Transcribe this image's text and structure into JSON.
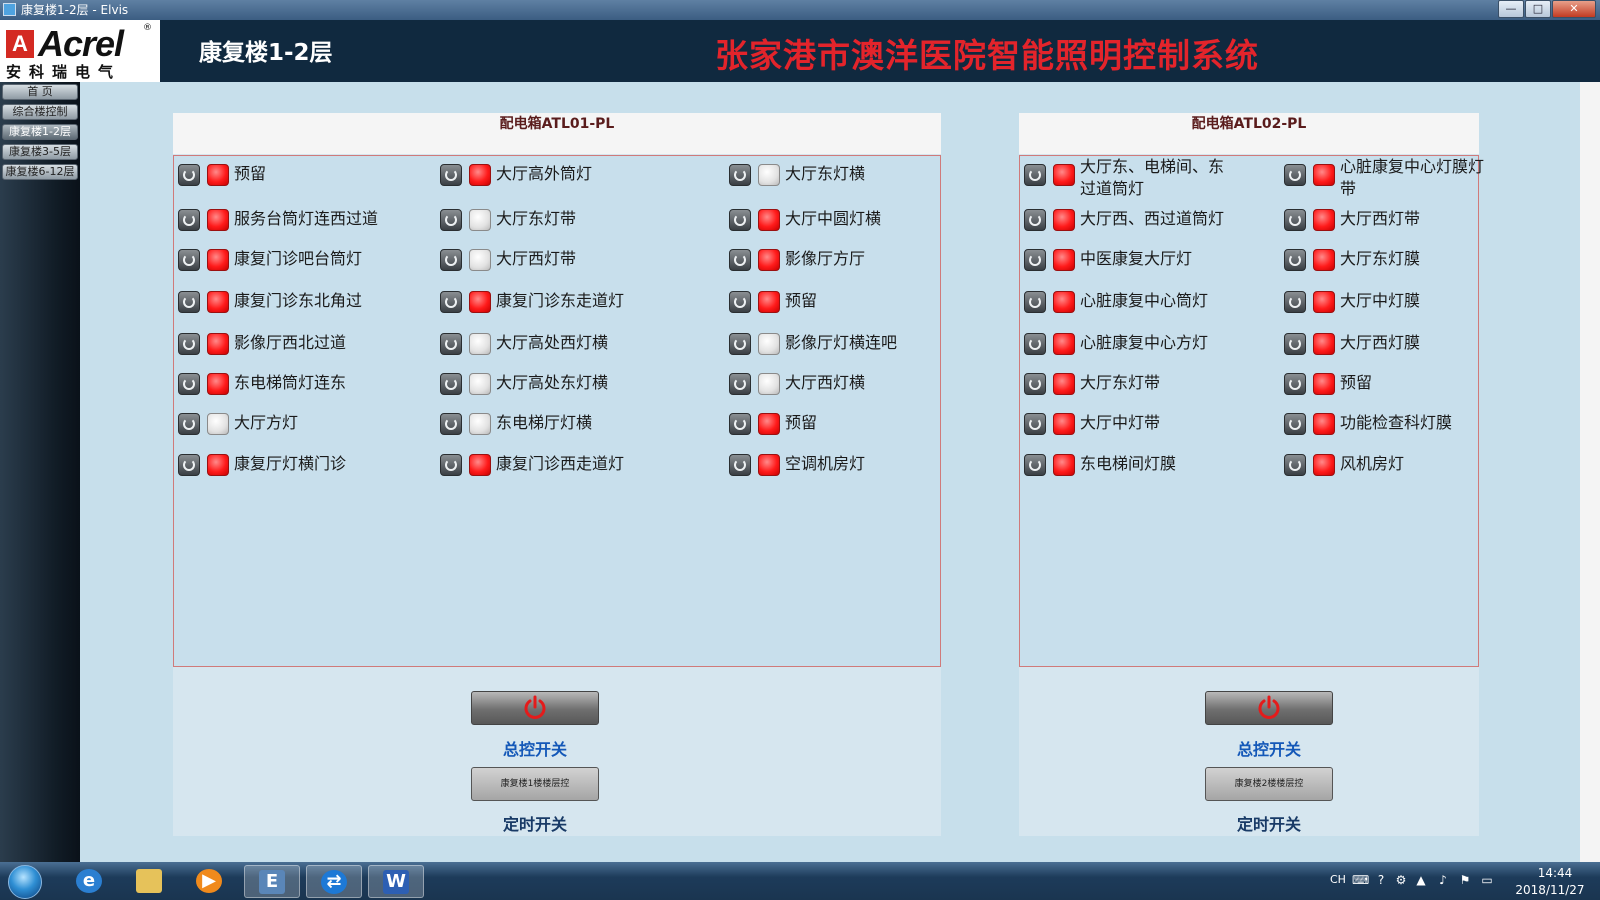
{
  "window": {
    "title": "康复楼1-2层 - Elvis",
    "minimize": "—",
    "maximize": "□",
    "close": "✕"
  },
  "header": {
    "logo_word": "Acrel",
    "logo_reg": "®",
    "logo_sub": "安科瑞电气",
    "floor_title": "康复楼1-2层",
    "system_title": "张家港市澳洋医院智能照明控制系统"
  },
  "sidebar": {
    "items": [
      {
        "label": "首 页",
        "active": false
      },
      {
        "label": "综合楼控制",
        "active": false
      },
      {
        "label": "康复楼1-2层",
        "active": true
      },
      {
        "label": "康复楼3-5层",
        "active": false
      },
      {
        "label": "康复楼6-12层",
        "active": false
      }
    ]
  },
  "panels": [
    {
      "title": "配电箱ATL01-PL",
      "columns": [
        [
          {
            "label": "预留",
            "on": true
          },
          {
            "label": "服务台筒灯连西过道",
            "on": true
          },
          {
            "label": "康复门诊吧台筒灯",
            "on": true
          },
          {
            "label": "康复门诊东北角过",
            "on": true
          },
          {
            "label": "影像厅西北过道",
            "on": true
          },
          {
            "label": "东电梯筒灯连东",
            "on": true
          },
          {
            "label": "大厅方灯",
            "on": false
          },
          {
            "label": "康复厅灯横门诊",
            "on": true
          }
        ],
        [
          {
            "label": "大厅高外筒灯",
            "on": true
          },
          {
            "label": "大厅东灯带",
            "on": false
          },
          {
            "label": "大厅西灯带",
            "on": false
          },
          {
            "label": "康复门诊东走道灯",
            "on": true
          },
          {
            "label": "大厅高处西灯横",
            "on": false
          },
          {
            "label": "大厅高处东灯横",
            "on": false
          },
          {
            "label": "东电梯厅灯横",
            "on": false
          },
          {
            "label": "康复门诊西走道灯",
            "on": true
          }
        ],
        [
          {
            "label": "大厅东灯横",
            "on": false
          },
          {
            "label": "大厅中圆灯横",
            "on": true
          },
          {
            "label": "影像厅方厅",
            "on": true
          },
          {
            "label": "预留",
            "on": true
          },
          {
            "label": "影像厅灯横连吧",
            "on": false
          },
          {
            "label": "大厅西灯横",
            "on": false
          },
          {
            "label": "预留",
            "on": true
          },
          {
            "label": "空调机房灯",
            "on": true
          }
        ]
      ],
      "master_label": "总控开关",
      "timer_button": "康复楼1楼楼层控",
      "timer_label": "定时开关"
    },
    {
      "title": "配电箱ATL02-PL",
      "columns": [
        [
          {
            "label": "大厅东、电梯间、东过道筒灯",
            "on": true
          },
          {
            "label": "大厅西、西过道筒灯",
            "on": true
          },
          {
            "label": "中医康复大厅灯",
            "on": true
          },
          {
            "label": "心脏康复中心筒灯",
            "on": true
          },
          {
            "label": "心脏康复中心方灯",
            "on": true
          },
          {
            "label": "大厅东灯带",
            "on": true
          },
          {
            "label": "大厅中灯带",
            "on": true
          },
          {
            "label": "东电梯间灯膜",
            "on": true
          }
        ],
        [
          {
            "label": "心脏康复中心灯膜灯带",
            "on": true
          },
          {
            "label": "大厅西灯带",
            "on": true
          },
          {
            "label": "大厅东灯膜",
            "on": true
          },
          {
            "label": "大厅中灯膜",
            "on": true
          },
          {
            "label": "大厅西灯膜",
            "on": true
          },
          {
            "label": "预留",
            "on": true
          },
          {
            "label": "功能检查科灯膜",
            "on": true
          },
          {
            "label": "风机房灯",
            "on": true
          }
        ]
      ],
      "master_label": "总控开关",
      "timer_button": "康复楼2楼楼层控",
      "timer_label": "定时开关"
    }
  ],
  "taskbar": {
    "apps": [
      "start-orb",
      "ie-icon",
      "explorer-icon",
      "media-player-icon",
      "elvis-app-icon",
      "teamviewer-icon",
      "word-icon"
    ],
    "lang": "CH",
    "time": "14:44",
    "date": "2018/11/27"
  },
  "colors": {
    "led_on": "#ff1b1b",
    "led_off": "#e2e2e2",
    "title_red": "#e3242b",
    "label_blue": "#1458b8"
  }
}
